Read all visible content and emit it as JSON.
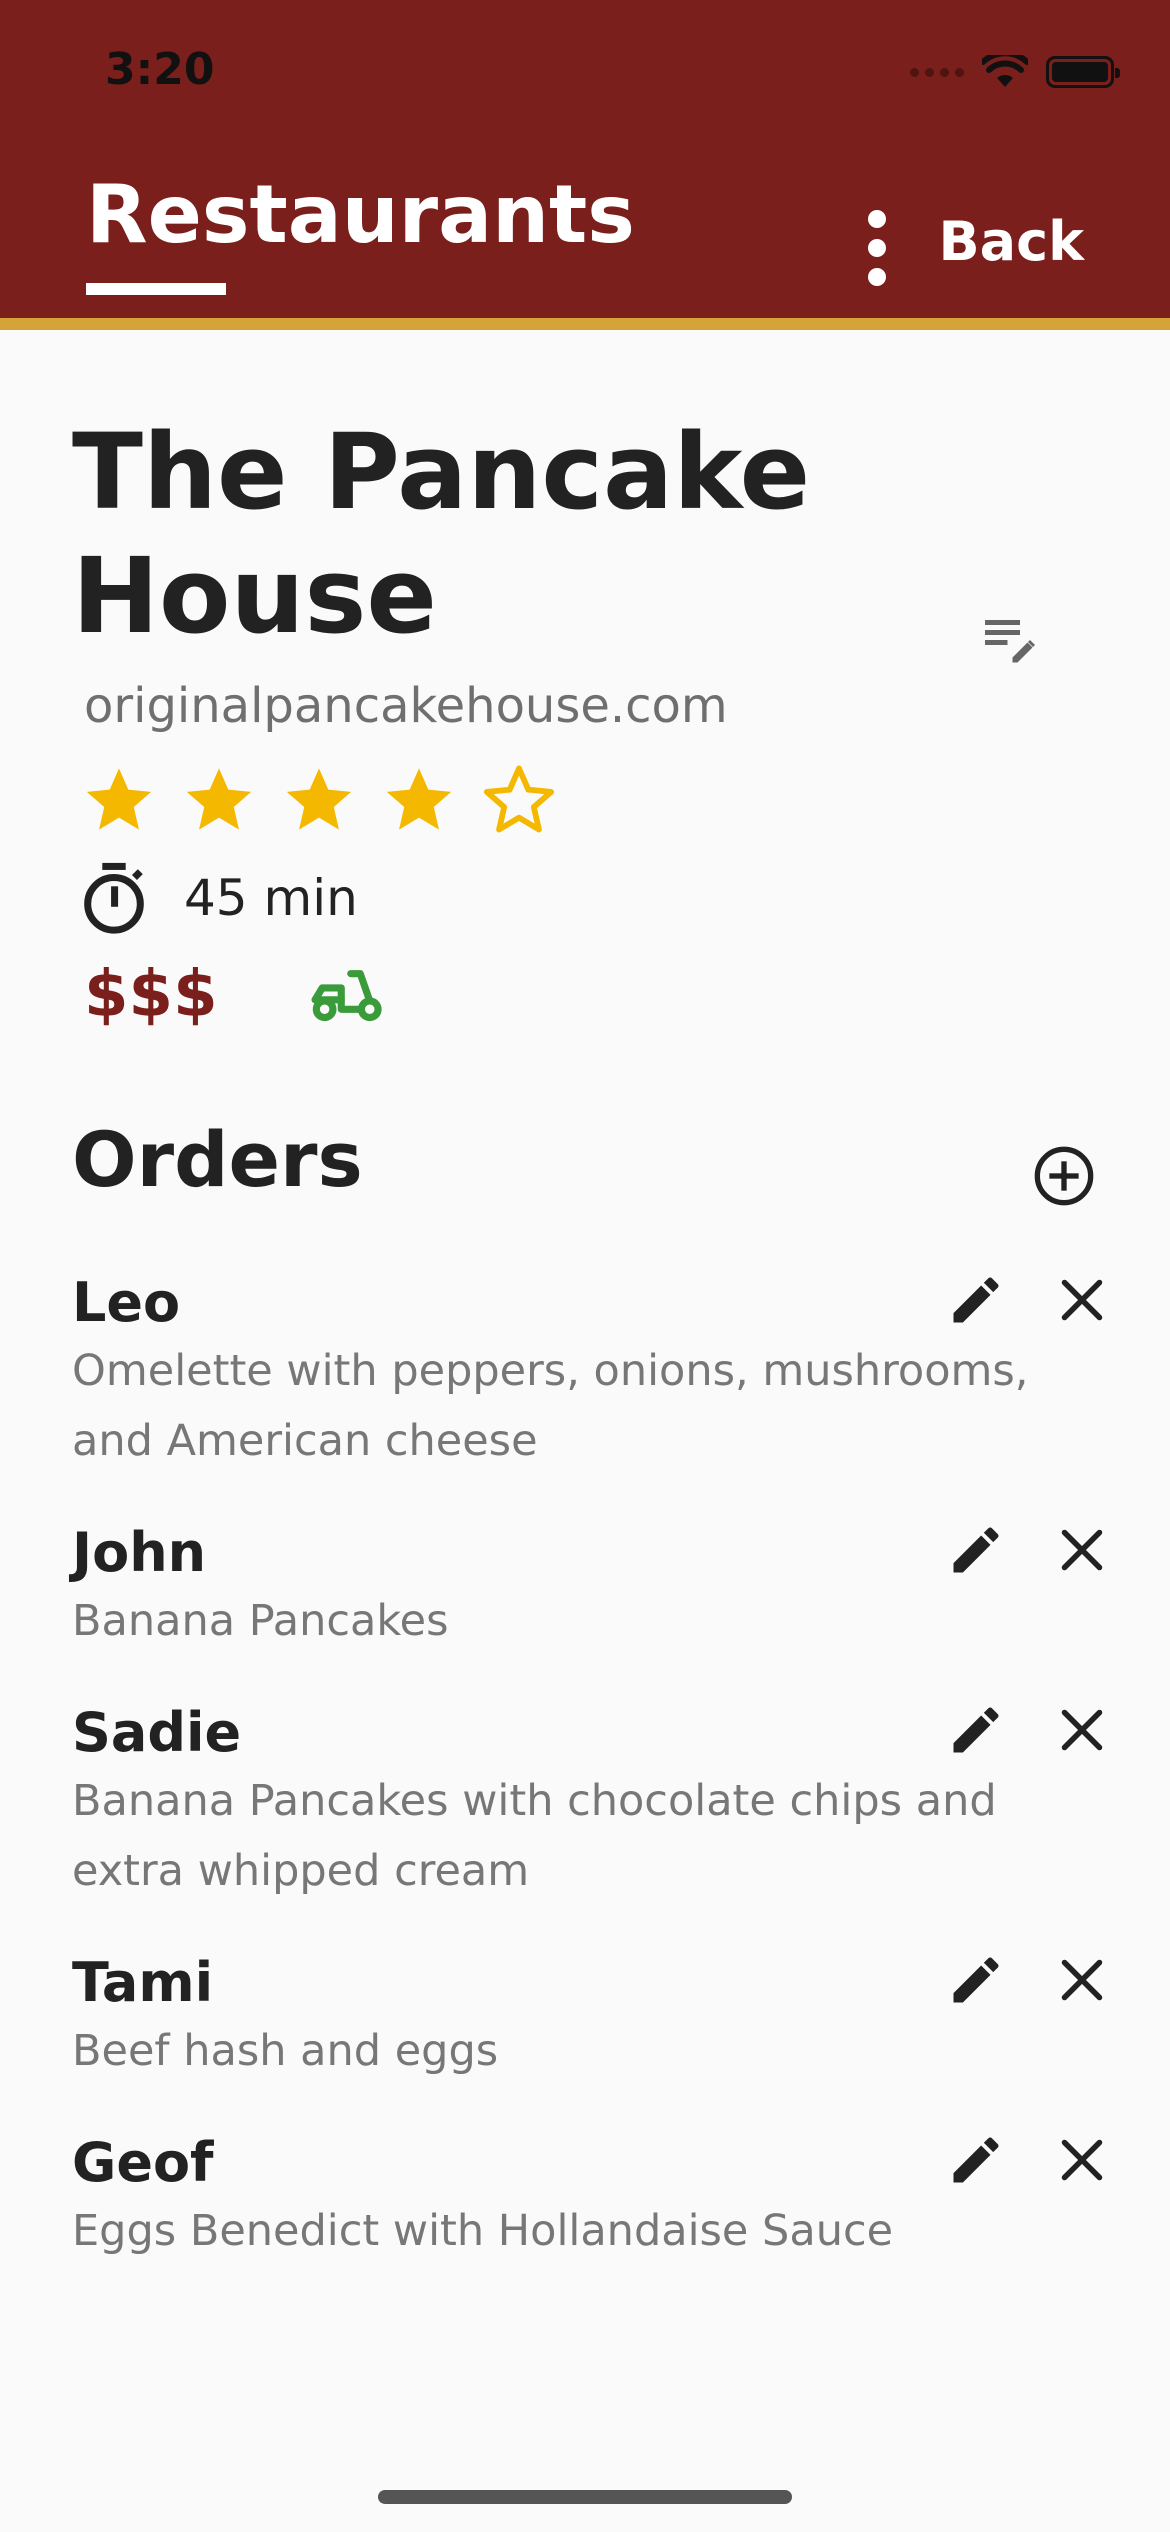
{
  "status_bar": {
    "time": "3:20"
  },
  "header": {
    "title": "Restaurants",
    "back_label": "Back"
  },
  "colors": {
    "brand": "#7a1f1b",
    "accent": "#d6a23a",
    "star": "#f5b800",
    "delivery": "#3a9b3a"
  },
  "restaurant": {
    "name": "The Pancake House",
    "website": "originalpancakehouse.com",
    "rating": 4,
    "rating_max": 5,
    "time": "45 min",
    "price": "$$$",
    "delivery_icon": "delivery-scooter-icon"
  },
  "orders": {
    "title": "Orders",
    "items": [
      {
        "name": "Leo",
        "description": "Omelette with peppers, onions, mushrooms, and American cheese"
      },
      {
        "name": "John",
        "description": "Banana Pancakes"
      },
      {
        "name": "Sadie",
        "description": "Banana Pancakes with chocolate chips and extra whipped cream"
      },
      {
        "name": "Tami",
        "description": "Beef hash and eggs"
      },
      {
        "name": "Geof",
        "description": "Eggs Benedict with Hollandaise Sauce"
      }
    ]
  }
}
